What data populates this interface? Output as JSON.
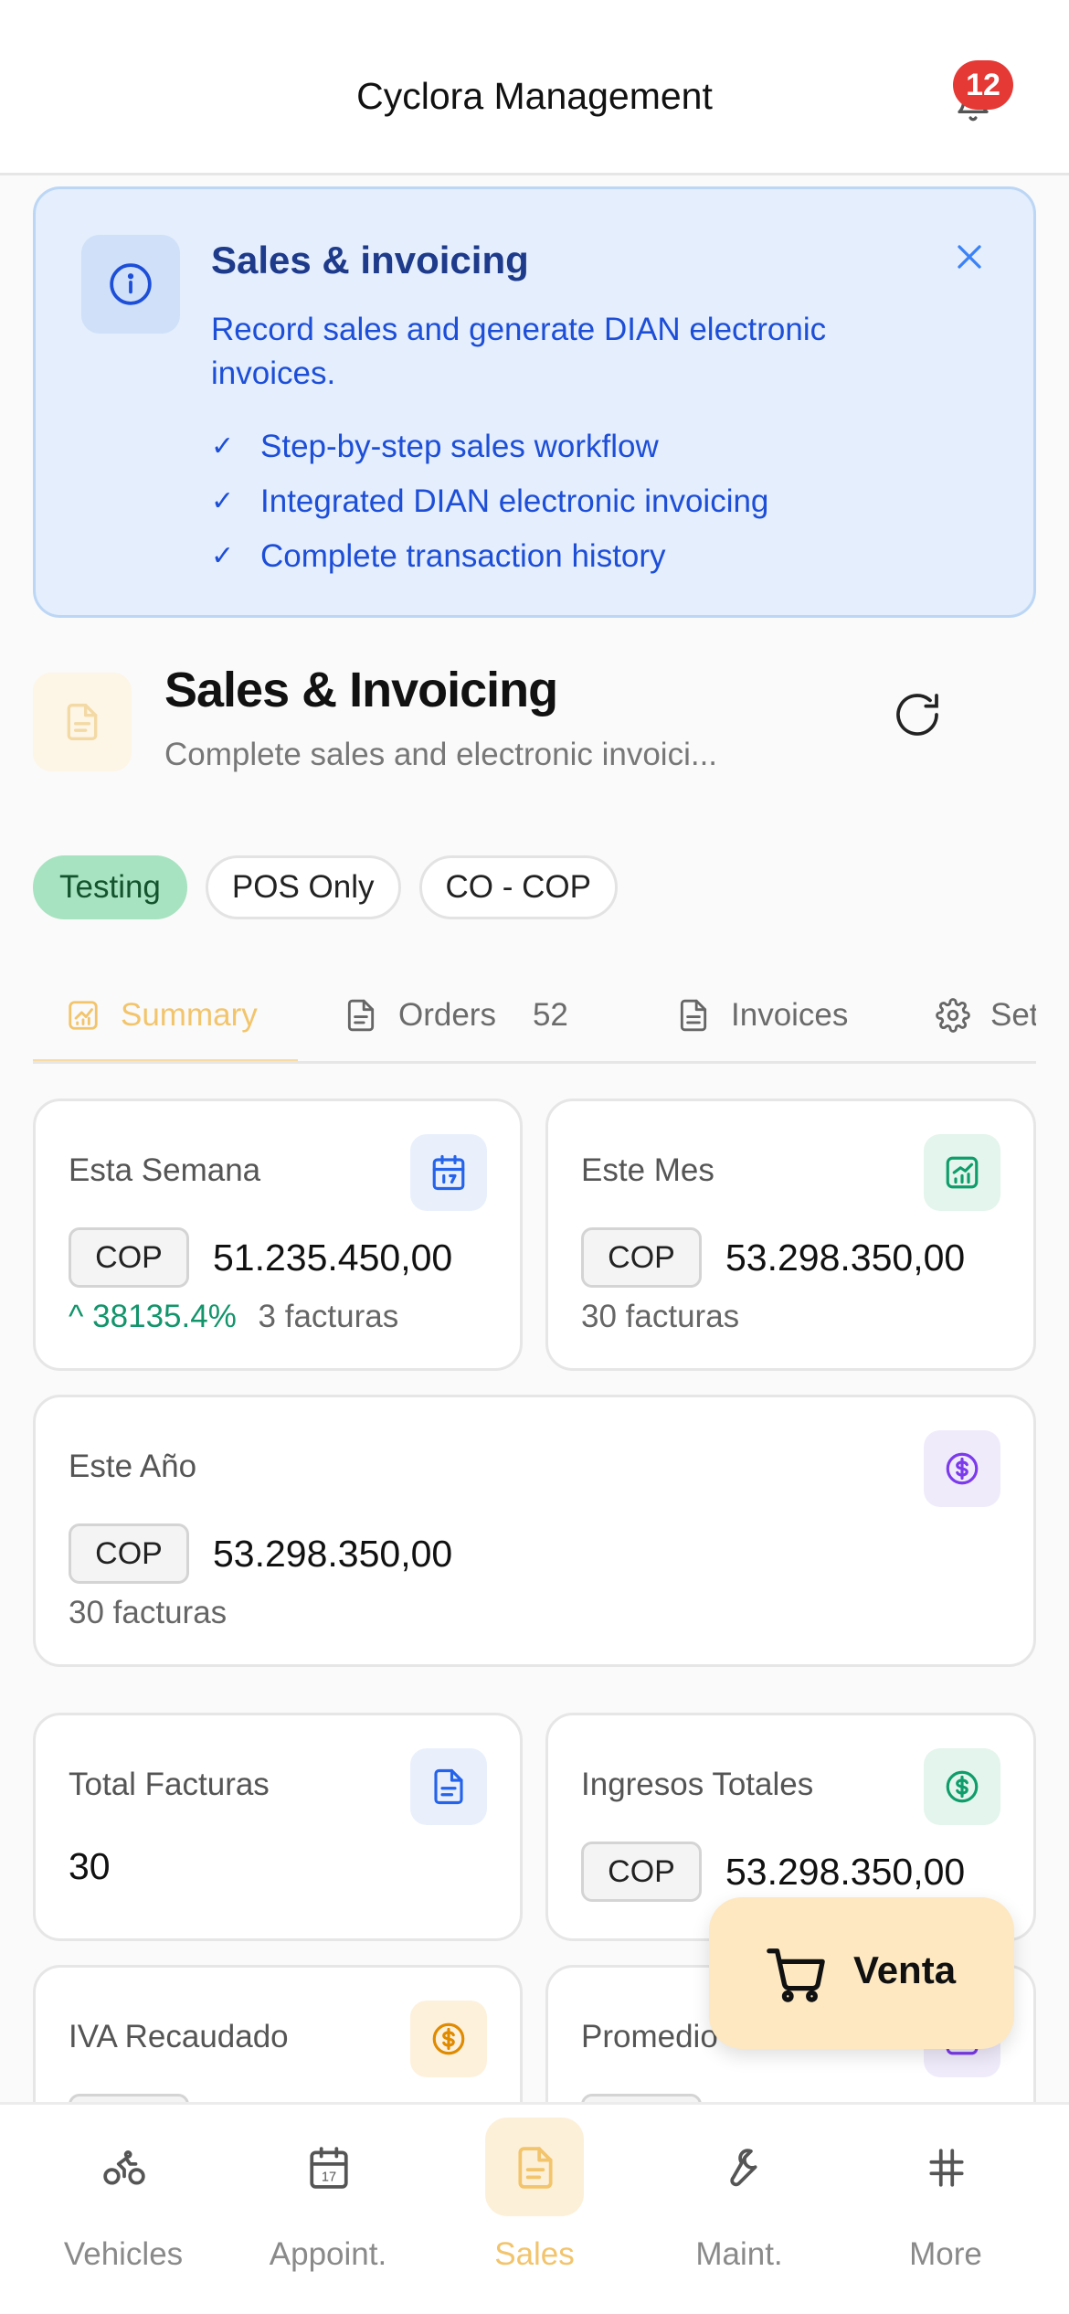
{
  "header": {
    "title": "Cyclora Management",
    "notification_count": "12"
  },
  "banner": {
    "title": "Sales & invoicing",
    "description": "Record sales and generate DIAN electronic invoices.",
    "features": [
      "Step-by-step sales workflow",
      "Integrated DIAN electronic invoicing",
      "Complete transaction history"
    ]
  },
  "section": {
    "title": "Sales & Invoicing",
    "subtitle": "Complete sales and electronic invoici..."
  },
  "chips": [
    "Testing",
    "POS Only",
    "CO - COP"
  ],
  "tabs": {
    "summary": "Summary",
    "orders": "Orders",
    "orders_count": "52",
    "invoices": "Invoices",
    "settings": "Settings"
  },
  "cards": {
    "week": {
      "label": "Esta Semana",
      "currency": "COP",
      "amount": "51.235.450,00",
      "trend": "38135.4%",
      "invoices": "3 facturas"
    },
    "month": {
      "label": "Este Mes",
      "currency": "COP",
      "amount": "53.298.350,00",
      "invoices": "30 facturas"
    },
    "year": {
      "label": "Este Año",
      "currency": "COP",
      "amount": "53.298.350,00",
      "invoices": "30 facturas"
    },
    "total_invoices": {
      "label": "Total Facturas",
      "value": "30"
    },
    "total_income": {
      "label": "Ingresos Totales",
      "currency": "COP",
      "amount": "53.298.350,00"
    },
    "iva": {
      "label": "IVA Recaudado"
    },
    "average": {
      "label": "Promedio"
    }
  },
  "fab": {
    "label": "Venta"
  },
  "nav": {
    "vehicles": "Vehicles",
    "appointments": "Appoint.",
    "appointments_icon_day": "17",
    "sales": "Sales",
    "maintenance": "Maint.",
    "more": "More"
  },
  "colors": {
    "accent": "#f2c46c",
    "info_blue": "#1d4ed8",
    "success_green": "#13946b",
    "danger_red": "#e53935"
  }
}
